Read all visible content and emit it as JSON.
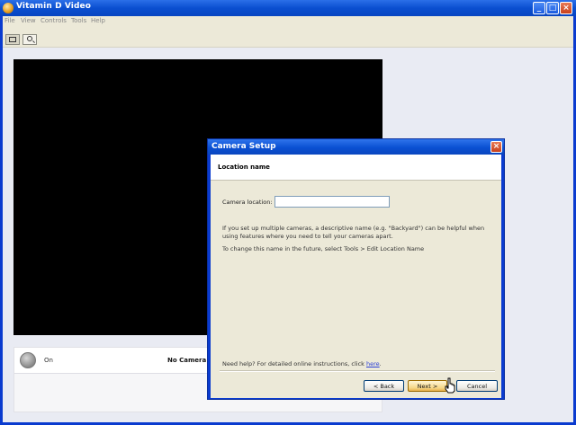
{
  "window": {
    "title": "Vitamin D Video",
    "minimize_glyph": "_",
    "maximize_glyph": "□",
    "close_glyph": "×"
  },
  "menu": {
    "items": [
      "File",
      "View",
      "Controls",
      "Tools",
      "Help"
    ]
  },
  "toolbar": {
    "buttons": [
      "grid-view-icon",
      "magnifier-icon"
    ]
  },
  "status": {
    "state": "On",
    "message": "No Camera S"
  },
  "dialog": {
    "title": "Camera Setup",
    "close_glyph": "×",
    "header": "Location name",
    "field_label": "Camera location:",
    "field_value": "",
    "paragraph1": "If you set up multiple cameras, a descriptive name (e.g. \"Backyard\") can be helpful when using features where you need to tell your cameras apart.",
    "paragraph2": "To change this name in the future, select Tools > Edit Location Name",
    "help_text": "Need help?  For detailed online instructions, click ",
    "help_link": "here",
    "help_suffix": ".",
    "buttons": {
      "back": "< Back",
      "next": "Next >",
      "cancel": "Cancel"
    }
  },
  "colors": {
    "titlebar": "#0a50d2",
    "dialog_bg": "#ece9d8",
    "video_bg": "#000000"
  }
}
